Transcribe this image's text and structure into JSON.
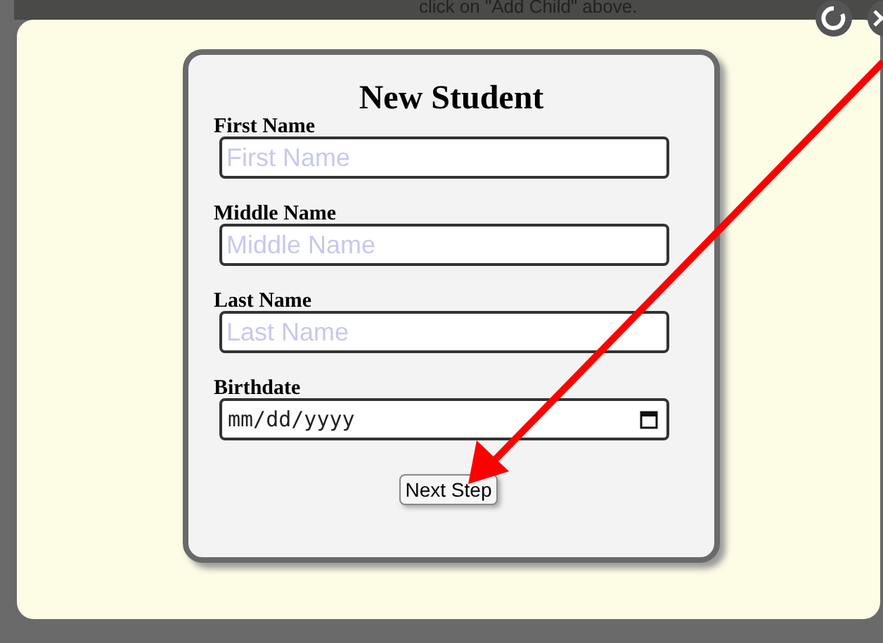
{
  "background_text": "click on \"Add Child\" above.",
  "form": {
    "title": "New Student",
    "fields": [
      {
        "kind": "text",
        "label": "First Name",
        "placeholder": "First Name"
      },
      {
        "kind": "text",
        "label": "Middle Name",
        "placeholder": "Middle Name"
      },
      {
        "kind": "text",
        "label": "Last Name",
        "placeholder": "Last Name"
      },
      {
        "kind": "date",
        "label": "Birthdate",
        "value": "mm/dd/yyyy"
      }
    ],
    "button": "Next Step"
  }
}
